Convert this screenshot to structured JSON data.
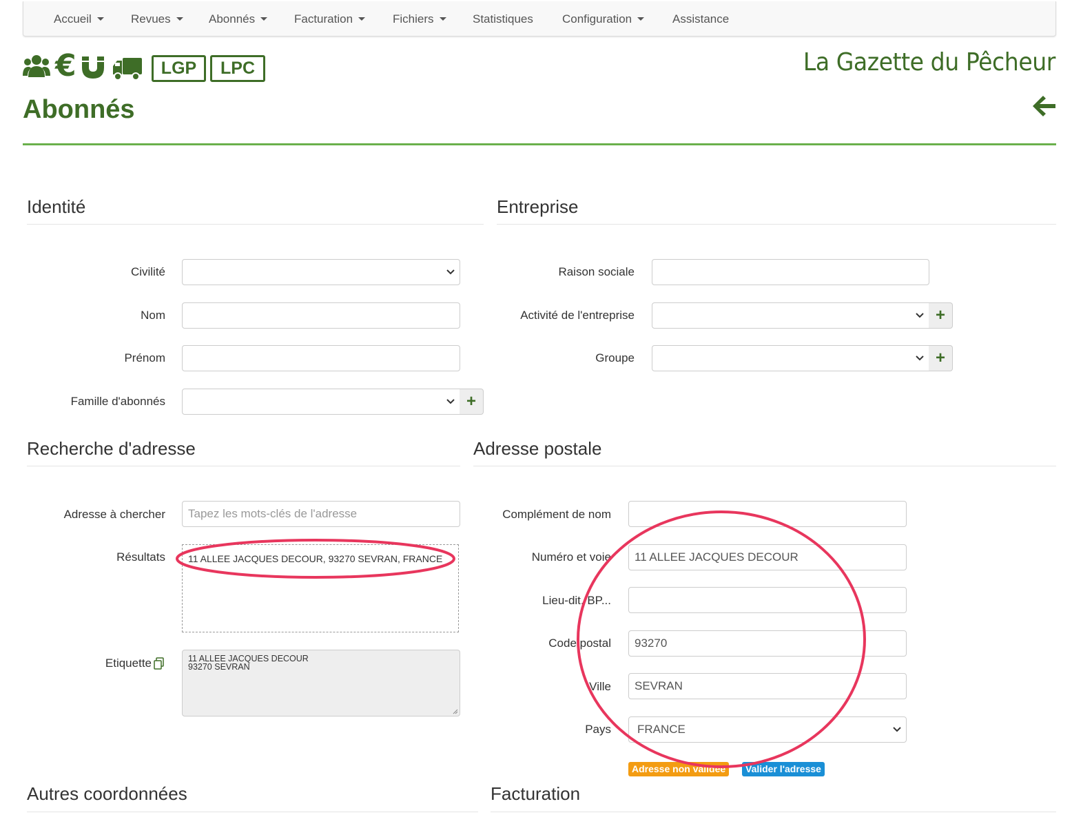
{
  "nav": {
    "items": [
      {
        "label": "Accueil",
        "dropdown": true
      },
      {
        "label": "Revues",
        "dropdown": true
      },
      {
        "label": "Abonnés",
        "dropdown": true
      },
      {
        "label": "Facturation",
        "dropdown": true
      },
      {
        "label": "Fichiers",
        "dropdown": true
      },
      {
        "label": "Statistiques",
        "dropdown": false
      },
      {
        "label": "Configuration",
        "dropdown": true
      },
      {
        "label": "Assistance",
        "dropdown": false
      }
    ]
  },
  "header": {
    "icons": [
      "users-icon",
      "euro-icon",
      "magnet-icon",
      "truck-icon"
    ],
    "tags": [
      "LGP",
      "LPC"
    ],
    "brand": "La Gazette du Pêcheur",
    "title": "Abonnés"
  },
  "identite": {
    "title": "Identité",
    "civilite_label": "Civilité",
    "civilite_value": "",
    "nom_label": "Nom",
    "nom_value": "",
    "prenom_label": "Prénom",
    "prenom_value": "",
    "famille_label": "Famille d'abonnés",
    "famille_value": ""
  },
  "entreprise": {
    "title": "Entreprise",
    "raison_label": "Raison sociale",
    "raison_value": "",
    "activite_label": "Activité de l'entreprise",
    "activite_value": "",
    "groupe_label": "Groupe",
    "groupe_value": ""
  },
  "recherche": {
    "title": "Recherche d'adresse",
    "adresse_label": "Adresse à chercher",
    "adresse_placeholder": "Tapez les mots-clés de l'adresse",
    "resultats_label": "Résultats",
    "results": [
      "11 ALLEE JACQUES DECOUR, 93270 SEVRAN, FRANCE"
    ],
    "etiquette_label": "Etiquette",
    "etiquette_lines": [
      "11 ALLEE JACQUES DECOUR",
      "93270 SEVRAN"
    ]
  },
  "postale": {
    "title": "Adresse postale",
    "complement_label": "Complément de nom",
    "complement_value": "",
    "numero_label": "Numéro et voie",
    "numero_value": "11 ALLEE JACQUES DECOUR",
    "lieudit_label": "Lieu-dit, BP...",
    "lieudit_value": "",
    "cp_label": "Code postal",
    "cp_value": "93270",
    "ville_label": "Ville",
    "ville_value": "SEVRAN",
    "pays_label": "Pays",
    "pays_value": "FRANCE",
    "badge_invalid": "Adresse non validée",
    "badge_validate": "Valider l'adresse"
  },
  "autres": {
    "title": "Autres coordonnées"
  },
  "facturation": {
    "title": "Facturation"
  },
  "colors": {
    "primary_green": "#3e6d27",
    "rule_green": "#6ab04c",
    "annotation_red": "#e8365d",
    "badge_orange": "#f39c12",
    "badge_blue": "#1a8fd6"
  }
}
